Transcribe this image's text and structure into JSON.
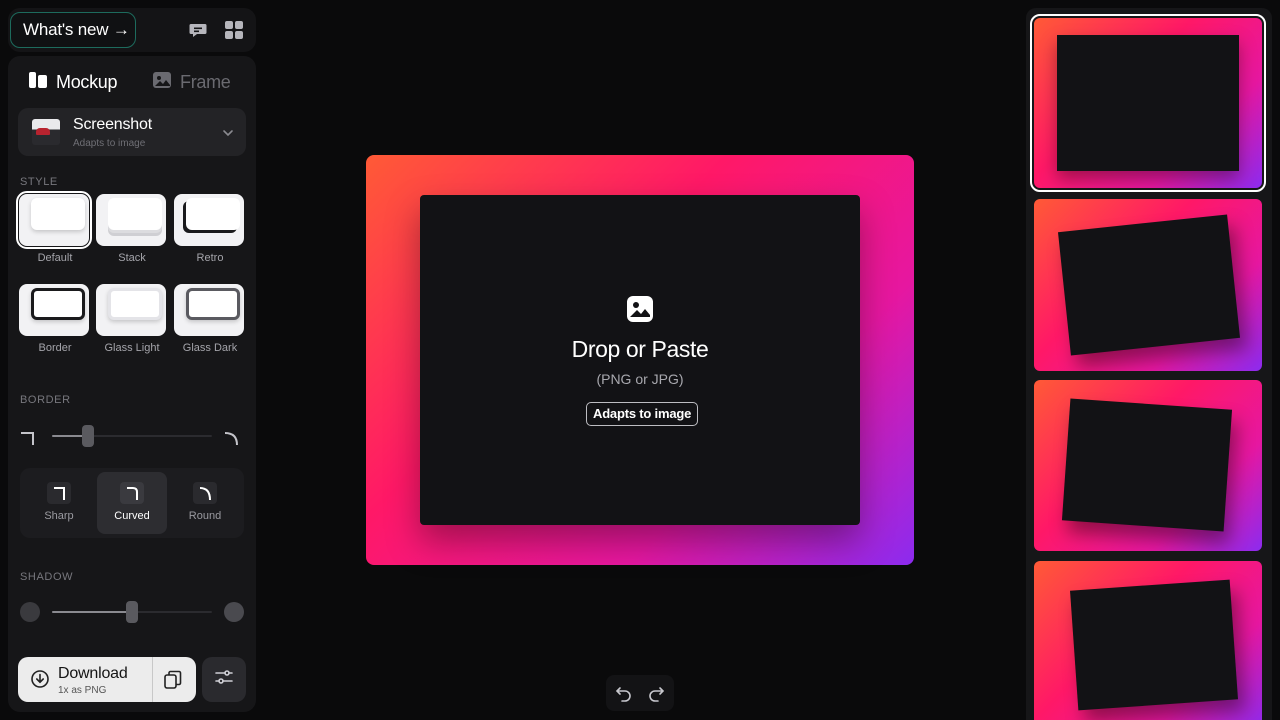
{
  "header": {
    "whats_new_label": "What's new →",
    "icons": [
      "chat-icon",
      "grid-icon"
    ]
  },
  "sidebar": {
    "tabs": [
      {
        "label": "Mockup",
        "icon": "mockup-icon",
        "active": true
      },
      {
        "label": "Frame",
        "icon": "frame-icon",
        "active": false
      }
    ],
    "source": {
      "title": "Screenshot",
      "subtitle": "Adapts to image"
    },
    "style_section": {
      "label": "STYLE",
      "selected": "Default",
      "items": [
        "Default",
        "Stack",
        "Retro",
        "Border",
        "Glass Light",
        "Glass Dark"
      ]
    },
    "border_section": {
      "label": "BORDER",
      "radius_fraction": 0.2,
      "corner_options": [
        "Sharp",
        "Curved",
        "Round"
      ],
      "selected_corner": "Curved"
    },
    "shadow_section": {
      "label": "SHADOW",
      "level_fraction": 0.5
    }
  },
  "download": {
    "label": "Download",
    "sub": "1x as PNG"
  },
  "canvas": {
    "drop_title": "Drop or Paste",
    "drop_sub": "(PNG or JPG)",
    "badge": "Adapts to image",
    "gradient": [
      "#ff5a36",
      "#ff1867",
      "#e617a0",
      "#8c2bef"
    ]
  },
  "colors": {
    "background": "#0a0a0b",
    "panel": "#161618",
    "accent_outline": "#1d6b5d"
  }
}
